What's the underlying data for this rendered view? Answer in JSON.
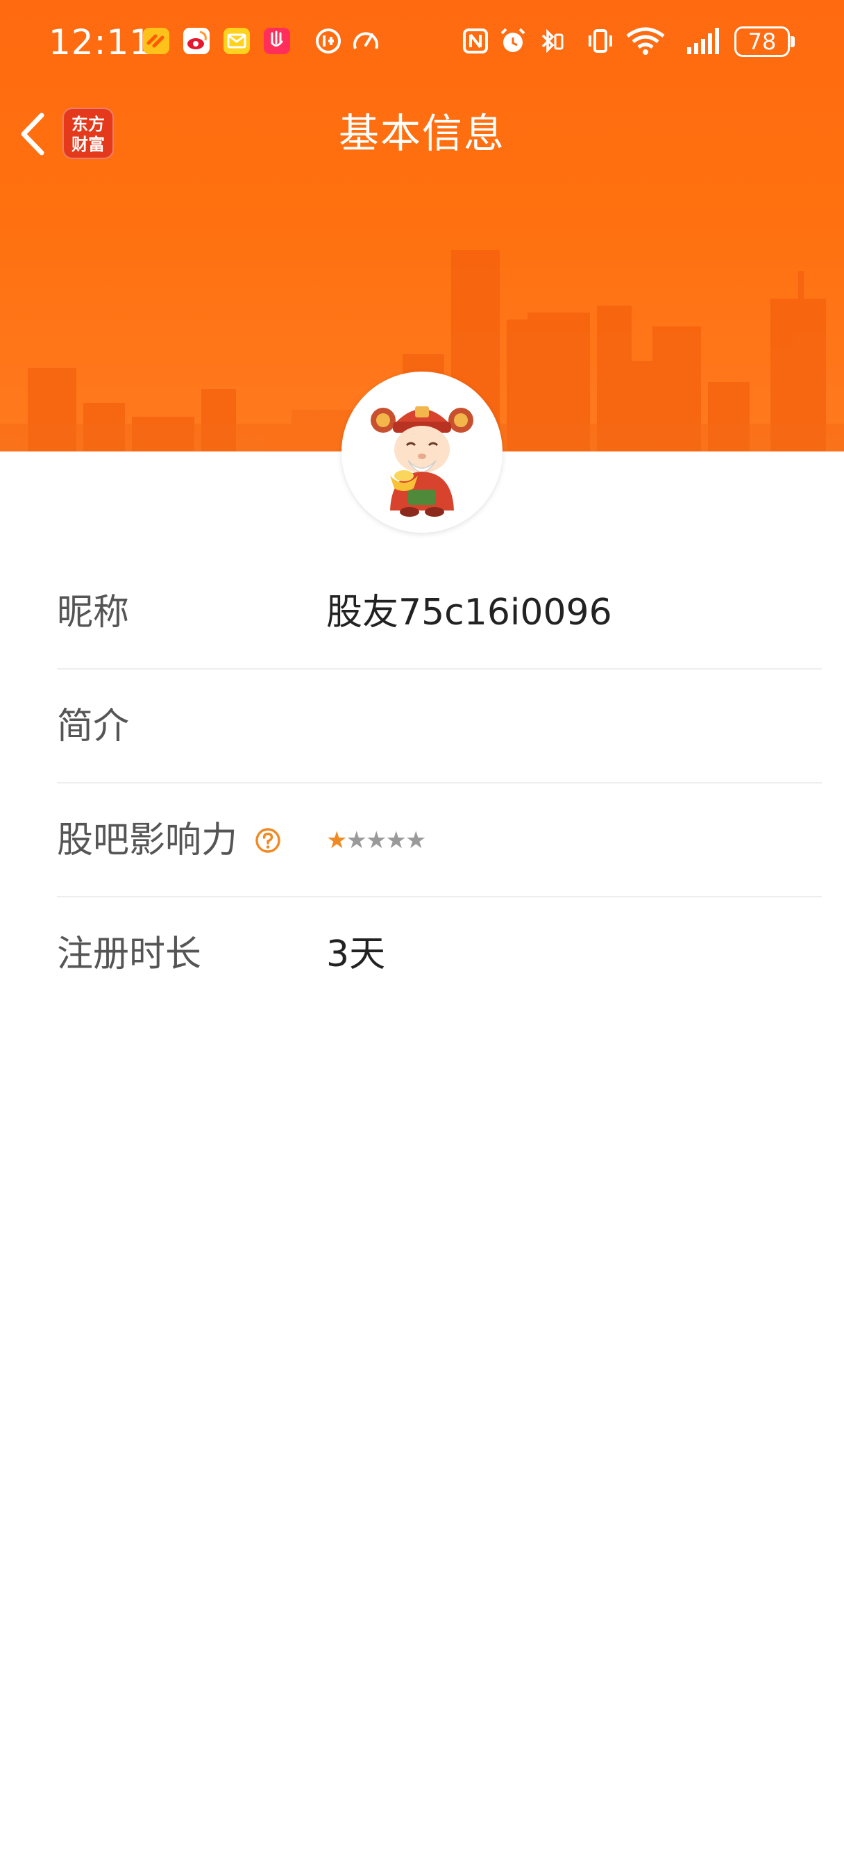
{
  "status_bar": {
    "time": "12:11",
    "battery": "78",
    "icons": [
      "taobao-icon",
      "weibo-icon",
      "mail-icon",
      "app-icon",
      "data-saver-icon",
      "speed-icon",
      "nfc-icon",
      "alarm-icon",
      "bluetooth-icon",
      "vibrate-icon",
      "wifi-icon",
      "signal-icon"
    ]
  },
  "nav": {
    "title": "基本信息",
    "logo_line1": "东方",
    "logo_line2": "财富"
  },
  "profile": {
    "avatar_icon": "caishen-avatar",
    "fields": [
      {
        "label": "昵称",
        "value": "股友75c16i0096"
      },
      {
        "label": "简介",
        "value": ""
      },
      {
        "label": "股吧影响力",
        "rating": 1,
        "rating_max": 5
      },
      {
        "label": "注册时长",
        "value": "3天"
      }
    ]
  },
  "colors": {
    "header": "#ff6a10",
    "star_active": "#f08a24",
    "star_inactive": "#9a9a9a",
    "help_icon": "#f08a24"
  }
}
